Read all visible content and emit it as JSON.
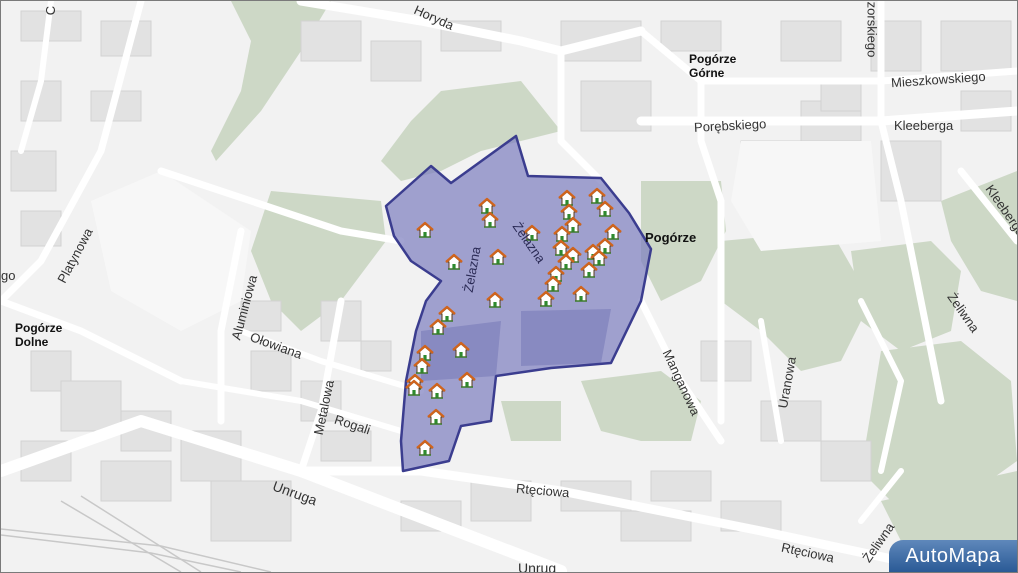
{
  "map": {
    "streets": [
      {
        "id": "horyda",
        "text": "Horyda"
      },
      {
        "id": "zorskiego",
        "text": "zorskiego"
      },
      {
        "id": "mieszkowskiego",
        "text": "Mieszkowskiego"
      },
      {
        "id": "porebskiego",
        "text": "Porębskiego"
      },
      {
        "id": "kleeberga",
        "text": "Kleeberga"
      },
      {
        "id": "kleeberga2",
        "text": "Kleeberga"
      },
      {
        "id": "platynowa",
        "text": "Platynowa"
      },
      {
        "id": "aluminiowa",
        "text": "Aluminiowa"
      },
      {
        "id": "olowiana",
        "text": "Ołowiana"
      },
      {
        "id": "metalowa",
        "text": "Metalowa"
      },
      {
        "id": "rogali",
        "text": "Rogali"
      },
      {
        "id": "unruga",
        "text": "Unruga"
      },
      {
        "id": "unruga2",
        "text": "Unrug"
      },
      {
        "id": "rteciowa",
        "text": "Rtęciowa"
      },
      {
        "id": "rteciowa2",
        "text": "Rtęciowa"
      },
      {
        "id": "zelazna",
        "text": "Żelazna"
      },
      {
        "id": "zelazna2",
        "text": "Żelazna"
      },
      {
        "id": "manganowa",
        "text": "Manganowa"
      },
      {
        "id": "uranowa",
        "text": "Uranowa"
      },
      {
        "id": "zeliwna",
        "text": "Żeliwna"
      },
      {
        "id": "zeliwna2",
        "text": "Żeliwna"
      },
      {
        "id": "c-edge",
        "text": "C"
      },
      {
        "id": "go-edge",
        "text": "go"
      }
    ],
    "places": [
      {
        "id": "pogorze-gorne",
        "text": "Pogórze Górne"
      },
      {
        "id": "pogorze",
        "text": "Pogórze"
      },
      {
        "id": "pogorze-dolne",
        "text": "Pogórze Dolne"
      }
    ],
    "marker_icon": "house-icon",
    "marker_count": 46,
    "colors": {
      "highlight_fill": "#7e7fbf",
      "highlight_stroke": "#3b3d8f",
      "forest": "#cfd9c8",
      "road": "#ffffff"
    }
  },
  "branding": {
    "logo_text": "AutoMapa"
  }
}
